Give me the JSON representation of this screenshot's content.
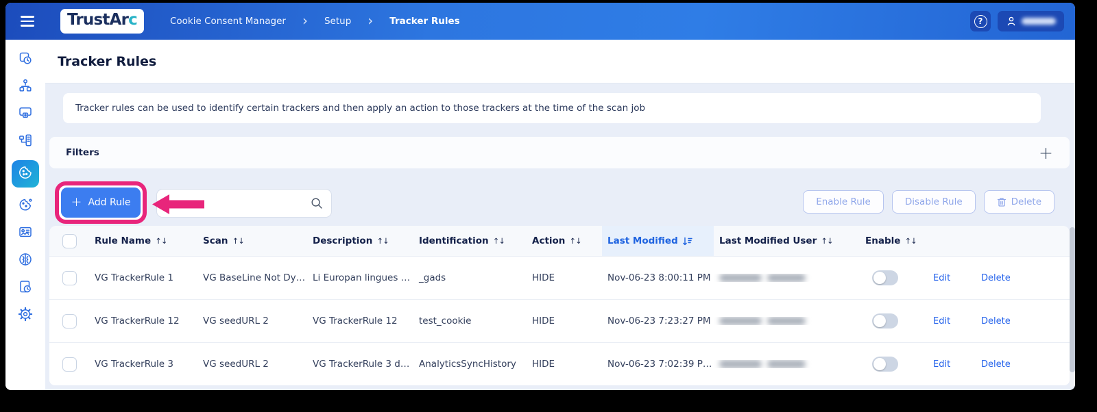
{
  "header": {
    "logo_prefix": "TrustAr",
    "logo_suffix": "c",
    "breadcrumb": {
      "items": [
        "Cookie Consent Manager",
        "Setup",
        "Tracker Rules"
      ]
    },
    "help": "?",
    "user_name_redacted": true
  },
  "icons": {
    "plus": "+",
    "chevron": "›",
    "sort": "↑↓"
  },
  "sidebar": {
    "active_item": "cookie-consent",
    "item_count": 10
  },
  "page": {
    "title": "Tracker Rules",
    "description": "Tracker rules can be used to identify certain trackers and then apply an action to those trackers at the time of the scan job"
  },
  "filters": {
    "label": "Filters"
  },
  "toolbar": {
    "add_rule": "Add Rule",
    "search_value": "",
    "enable_rule": "Enable Rule",
    "disable_rule": "Disable Rule",
    "delete": "Delete"
  },
  "annotation": {
    "highlight_color": "#e8257b"
  },
  "table": {
    "columns": [
      "Rule Name",
      "Scan",
      "Description",
      "Identification",
      "Action",
      "Last Modified",
      "Last Modified User",
      "Enable"
    ],
    "sorted_column": "Last Modified",
    "sort_direction": "desc",
    "row_actions": {
      "edit": "Edit",
      "delete": "Delete"
    },
    "rows": [
      {
        "rule_name": "VG TrackerRule 1",
        "scan": "VG BaseLine Not Dy…",
        "description": "Li Europan lingues …",
        "identification": "_gads",
        "action": "HIDE",
        "last_modified": "Nov-06-23 8:00:11 PM",
        "last_modified_user_redacted": true,
        "enabled": false
      },
      {
        "rule_name": "VG TrackerRule 12",
        "scan": "VG seedURL 2",
        "description": "VG TrackerRule 12",
        "identification": "test_cookie",
        "action": "HIDE",
        "last_modified": "Nov-06-23 7:23:27 PM",
        "last_modified_user_redacted": true,
        "enabled": false
      },
      {
        "rule_name": "VG TrackerRule 3",
        "scan": "VG seedURL 2",
        "description": "VG TrackerRule 3 d…",
        "identification": "AnalyticsSyncHistory",
        "action": "HIDE",
        "last_modified": "Nov-06-23 7:02:39 P…",
        "last_modified_user_redacted": true,
        "enabled": false
      }
    ]
  },
  "colors": {
    "topbar_blue": "#2d76e0",
    "primary_button": "#3c7df0",
    "annotation_pink": "#e8257b",
    "link_blue": "#2563eb",
    "active_sort_blue": "#1e63e0",
    "sidebar_active_gradient": "#1d83e6"
  }
}
